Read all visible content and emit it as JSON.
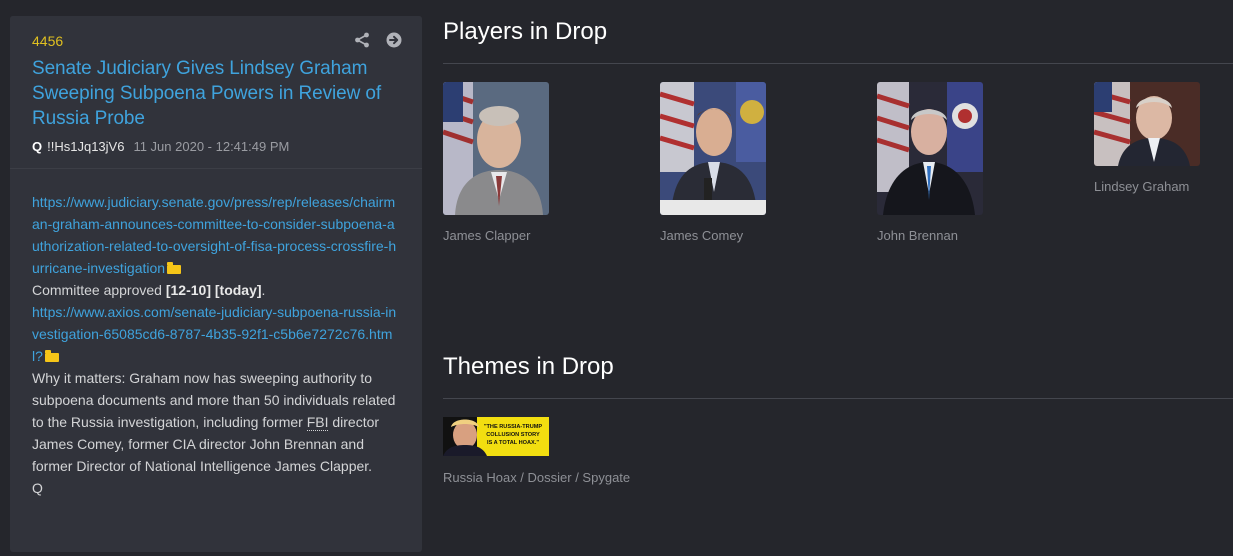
{
  "post": {
    "number": "4456",
    "title": "Senate Judiciary Gives Lindsey Graham Sweeping Subpoena Powers in Review of Russia Probe",
    "author": "Q",
    "tripcode": "!!Hs1Jq13jV6",
    "timestamp": "11 Jun 2020 - 12:41:49 PM",
    "link1": "https://www.judiciary.senate.gov/press/rep/releases/chairman-graham-announces-committee-to-consider-subpoena-authorization-related-to-oversight-of-fisa-process-crossfire-hurricane-investigation",
    "line_committee_prefix": "Committee approved ",
    "line_committee_vote": "[12-10]",
    "line_committee_space": " ",
    "line_committee_today": "[today]",
    "line_committee_suffix": ".",
    "link2": "https://www.axios.com/senate-judiciary-subpoena-russia-investigation-65085cd6-8787-4b35-92f1-c5b6e7272c76.html?",
    "body_part1": "Why it matters: Graham now has sweeping authority to subpoena documents and more than 50 individuals related to the Russia investigation, including former ",
    "body_abbr": "FBI",
    "body_part2": " director James Comey, former CIA director John Brennan and former Director of National Intelligence James Clapper.",
    "signoff": "Q",
    "icons": {
      "share": "share-icon",
      "open": "arrow-right-circle-icon"
    }
  },
  "players_section": {
    "title": "Players in Drop",
    "players": [
      {
        "name": "James Clapper"
      },
      {
        "name": "James Comey"
      },
      {
        "name": "John Brennan"
      },
      {
        "name": "Lindsey Graham"
      }
    ]
  },
  "themes_section": {
    "title": "Themes in Drop",
    "themes": [
      {
        "name": "Russia Hoax / Dossier / Spygate",
        "image_text": "\"THE RUSSIA-TRUMP COLLUSION STORY IS A TOTAL HOAX.\""
      }
    ]
  },
  "colors": {
    "background": "#25262c",
    "card": "#31333b",
    "link": "#3fa3dd",
    "post_number": "#e0c020",
    "caption": "#8e9096"
  }
}
